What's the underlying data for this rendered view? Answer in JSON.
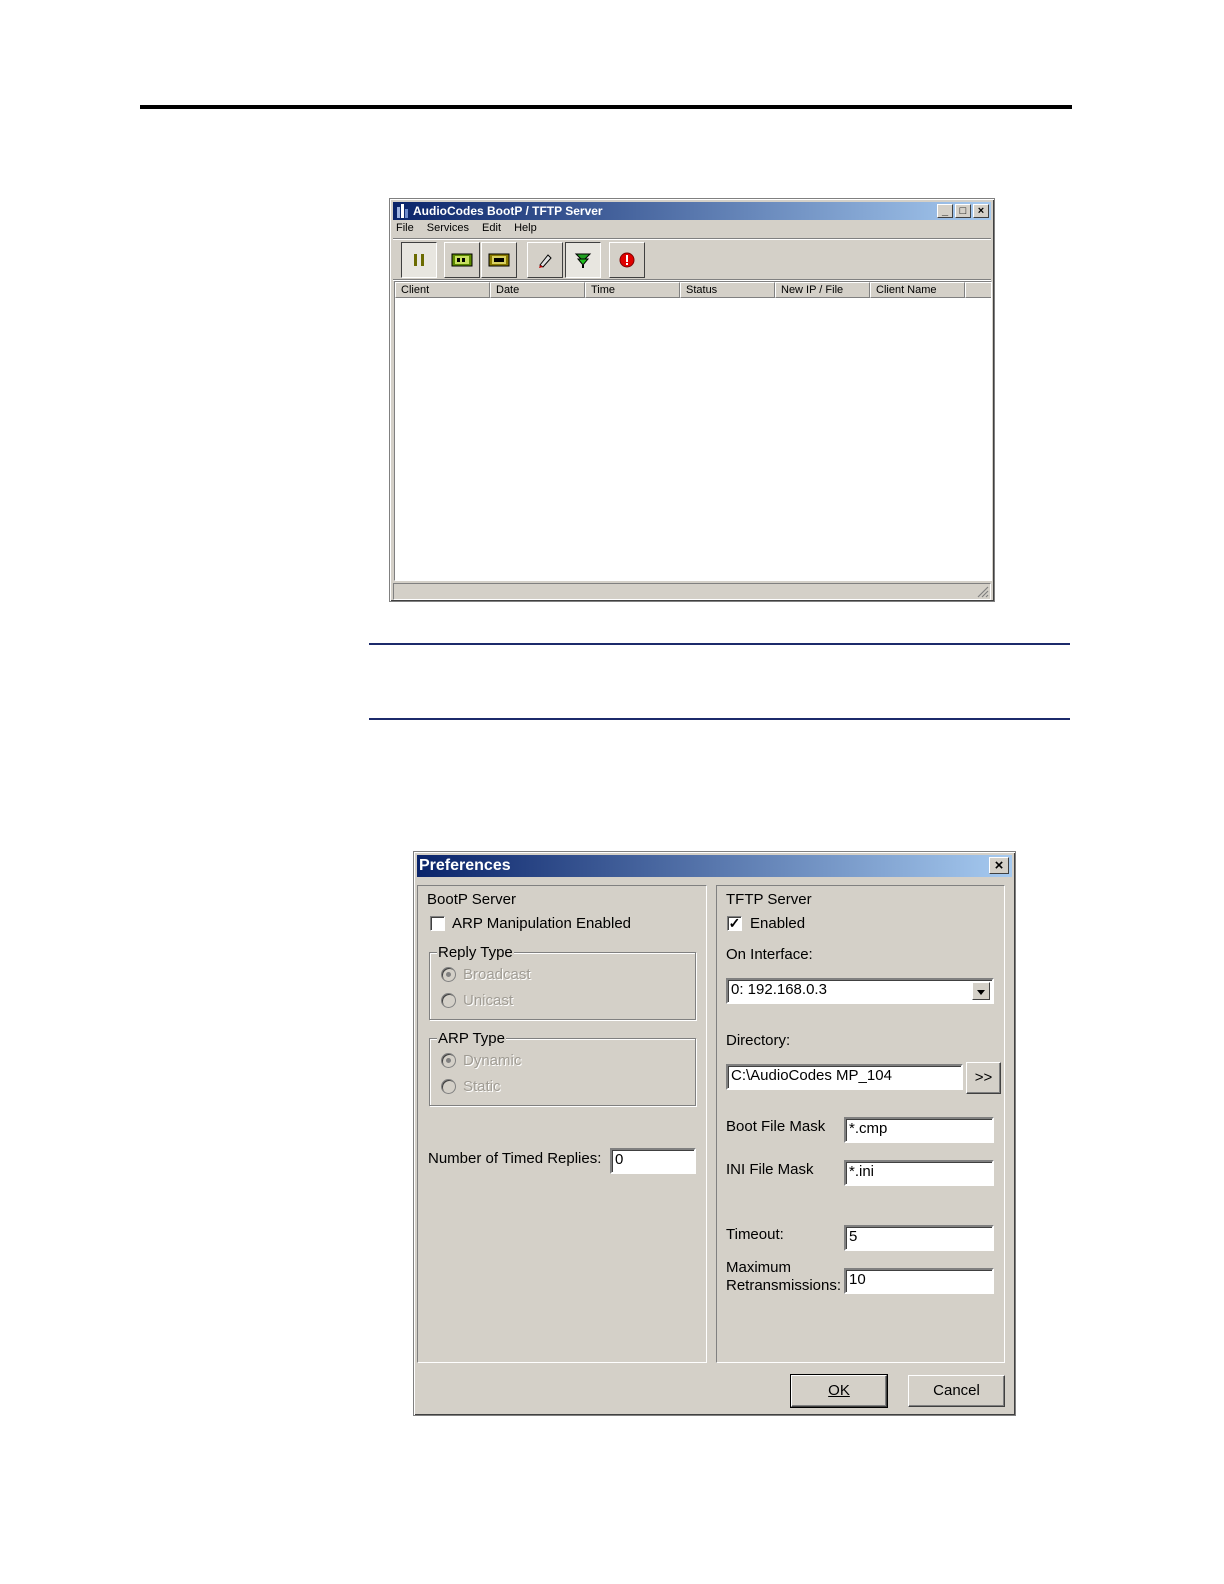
{
  "main_window": {
    "title": "AudioCodes BootP / TFTP Server",
    "caption_buttons": {
      "minimize": "_",
      "maximize": "□",
      "close": "×"
    },
    "menu": [
      "File",
      "Services",
      "Edit",
      "Help"
    ],
    "toolbar": [
      {
        "icon": "pause-icon",
        "pressed": true
      },
      {
        "icon": "bootp-clients-icon",
        "pressed": false
      },
      {
        "icon": "templates-icon",
        "pressed": false
      },
      {
        "icon": "clear-log-icon",
        "pressed": false
      },
      {
        "icon": "filter-clients-icon",
        "pressed": true
      },
      {
        "icon": "reset-icon",
        "pressed": false
      }
    ],
    "columns": [
      "Client",
      "Date",
      "Time",
      "Status",
      "New IP / File",
      "Client Name"
    ]
  },
  "preferences": {
    "title": "Preferences",
    "close": "×",
    "bootp": {
      "legend": "BootP Server",
      "arp_manipulation": {
        "label": "ARP Manipulation Enabled",
        "checked": false
      },
      "reply_type": {
        "legend": "Reply Type",
        "options": [
          "Broadcast",
          "Unicast"
        ],
        "selected": "Broadcast"
      },
      "arp_type": {
        "legend": "ARP Type",
        "options": [
          "Dynamic",
          "Static"
        ],
        "selected": "Dynamic"
      },
      "timed_replies": {
        "label": "Number of Timed Replies:",
        "value": "0"
      }
    },
    "tftp": {
      "legend": "TFTP Server",
      "enabled": {
        "label": "Enabled",
        "checked": true,
        "mark": "✓"
      },
      "interface_label": "On Interface:",
      "interface_value": "0: 192.168.0.3",
      "directory_label": "Directory:",
      "directory_value": "C:\\AudioCodes MP_104",
      "browse_label": ">>",
      "boot_mask_label": "Boot File Mask",
      "boot_mask_value": "*.cmp",
      "ini_mask_label": "INI File Mask",
      "ini_mask_value": "*.ini",
      "timeout_label": "Timeout:",
      "timeout_value": "5",
      "max_retrans_label_1": "Maximum",
      "max_retrans_label_2": "Retransmissions:",
      "max_retrans_value": "10"
    },
    "ok_label": "OK",
    "cancel_label": "Cancel"
  }
}
